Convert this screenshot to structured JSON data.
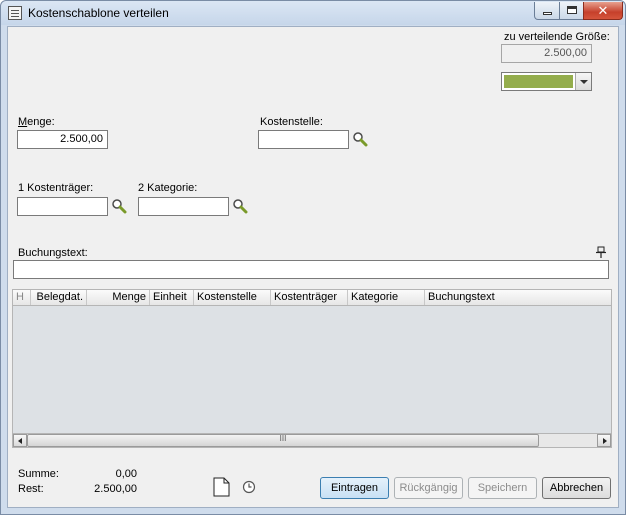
{
  "window": {
    "title": "Kostenschablone verteilen"
  },
  "distribute": {
    "label": "zu verteilende Größe:",
    "value": "2.500,00",
    "color_value": "#94ad4c"
  },
  "fields": {
    "menge_label": "Menge:",
    "menge_value": "2.500,00",
    "kostenstelle_label": "Kostenstelle:",
    "kostenstelle_value": "",
    "kostentraeger_label": "1 Kostenträger:",
    "kostentraeger_value": "",
    "kategorie_label": "2 Kategorie:",
    "kategorie_value": "",
    "buchungstext_label": "Buchungstext:",
    "buchungstext_value": ""
  },
  "grid": {
    "columns": [
      "H",
      "Belegdat.",
      "Menge",
      "Einheit",
      "Kostenstelle",
      "Kostenträger",
      "Kategorie",
      "Buchungstext"
    ],
    "scroll_grip": "III"
  },
  "summary": {
    "summe_label": "Summe:",
    "summe_value": "0,00",
    "rest_label": "Rest:",
    "rest_value": "2.500,00"
  },
  "buttons": {
    "eintragen": "Eintragen",
    "rueckgaengig": "Rückgängig",
    "speichern": "Speichern",
    "abbrechen": "Abbrechen"
  },
  "icons": {
    "close": "✕"
  }
}
